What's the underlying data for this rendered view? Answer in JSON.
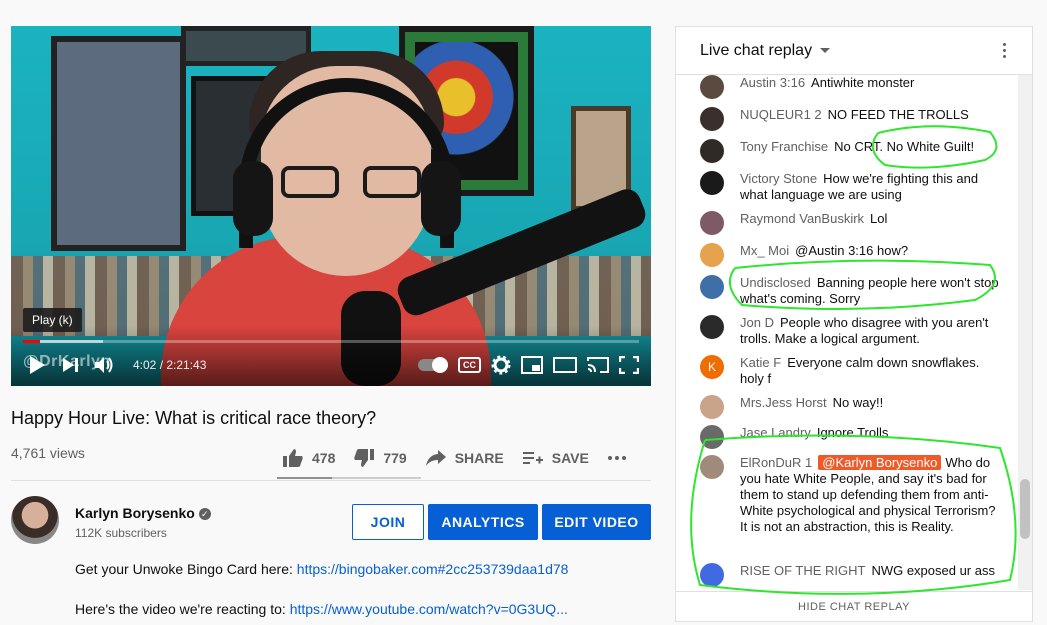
{
  "player": {
    "tooltip": "Play (k)",
    "watermark": "@DrKarlyn",
    "time": "4:02 / 2:21:43",
    "progress_fraction": 0.028,
    "buffered_fraction": 0.13
  },
  "video": {
    "title": "Happy Hour Live: What is critical race theory?",
    "views": "4,761 views",
    "likes": "478",
    "dislikes": "779",
    "share_label": "SHARE",
    "save_label": "SAVE",
    "like_fraction": 0.38
  },
  "channel": {
    "name": "Karlyn Borysenko",
    "subscribers": "112K subscribers",
    "join_label": "JOIN",
    "analytics_label": "ANALYTICS",
    "edit_label": "EDIT VIDEO"
  },
  "description": {
    "line1_text": "Get your Unwoke Bingo Card here: ",
    "line1_link": "https://bingobaker.com#2cc253739daa1d78",
    "line2_text": "Here's the video we're reacting to: ",
    "line2_link": "https://www.youtube.com/watch?v=0G3UQ..."
  },
  "chat": {
    "header": "Live chat replay",
    "hide_label": "HIDE CHAT REPLAY",
    "messages": [
      {
        "author": "Austin 3:16",
        "text": "Antiwhite monster",
        "avatar_color": "#5b4a3f"
      },
      {
        "author": "NUQLEUR1 2",
        "text": "NO FEED THE TROLLS",
        "avatar_color": "#3a2f2c"
      },
      {
        "author": "Tony Franchise",
        "text": "No CRT. No White Guilt!",
        "avatar_color": "#2f2a25"
      },
      {
        "author": "Victory Stone",
        "text": "How we're fighting this and what language we are using",
        "avatar_color": "#1a1a1a"
      },
      {
        "author": "Raymond VanBuskirk",
        "text": "Lol",
        "avatar_color": "#7d5a66"
      },
      {
        "author": "Mx_ Moi",
        "text": "@Austin 3:16 how?",
        "avatar_color": "#e6a24c"
      },
      {
        "author": "Undisclosed",
        "text": "Banning people here won't stop what's coming. Sorry",
        "avatar_color": "#3e6fa7"
      },
      {
        "author": "Jon D",
        "text": "People who disagree with you aren't trolls. Make a logical argument.",
        "avatar_color": "#2a2a2a"
      },
      {
        "author": "Katie F",
        "text": "Everyone calm down snowflakes. holy f",
        "avatar_color": "#ef6c00",
        "initial": "K"
      },
      {
        "author": "Mrs.Jess Horst",
        "text": "No way!!",
        "avatar_color": "#c9a38a"
      },
      {
        "author": "Jase Landry",
        "text": "Ignore Trolls",
        "avatar_color": "#6a6a6a"
      },
      {
        "author": "ElRonDuR 1",
        "mention": "@Karlyn Borysenko",
        "text": "Who do you hate White People, and say it's bad for them to stand up defending them from anti-White psychological and physical Terrorism? It is not an abstraction, this is Reality.",
        "avatar_color": "#a08a7a"
      },
      {
        "author": "RISE OF THE RIGHT",
        "text": "NWG exposed ur ass",
        "avatar_color": "#4169e1"
      }
    ]
  },
  "colors": {
    "accent_blue": "#065fd4",
    "progress_red": "#ff0000",
    "annotation_green": "#2ee62e"
  }
}
